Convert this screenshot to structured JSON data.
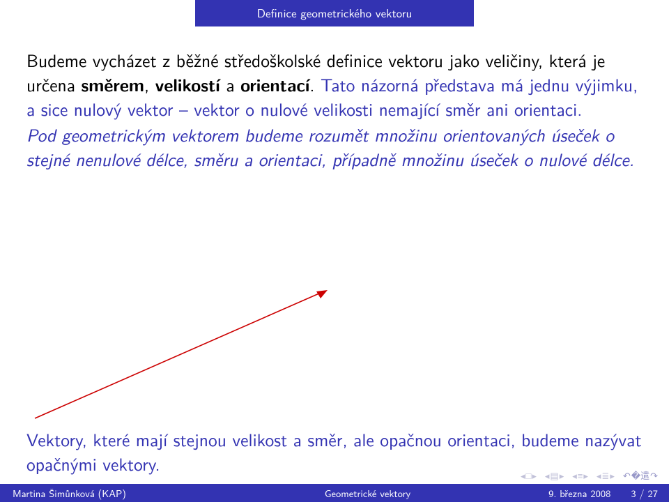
{
  "header": {
    "title": "Definice geometrického vektoru"
  },
  "body": {
    "p1_black": "Budeme vycházet z běžné středoškolské definice vektoru jako veličiny, která je určena ",
    "p1_bold1": "směrem",
    "p1_mid1": ", ",
    "p1_bold2": "velikostí",
    "p1_mid2": " a ",
    "p1_bold3": "orientací",
    "p1_end": ". ",
    "p1_blue": "Tato názorná představa má jednu výjimku, a sice nulový vektor – vektor o nulové velikosti nemající směr ani orientaci.",
    "p2_a": "Pod ",
    "p2_b": "geometrickým vektorem",
    "p2_c": " budeme rozumět množinu orientovaných úseček o stejné ",
    "p2_d": "nenulové",
    "p2_e": " délce, směru a orientaci, případně množinu úseček o ",
    "p2_f": "nulové",
    "p2_g": " délce."
  },
  "closing": {
    "text": "Vektory, které mají stejnou velikost a směr, ale opačnou orientaci, budeme nazývat opačnými vektory."
  },
  "footer": {
    "author": "Martina Šimůnková (KAP)",
    "title": "Geometrické vektory",
    "date": "9. března 2008",
    "page_cur": "3",
    "page_sep": " / ",
    "page_tot": "27"
  }
}
